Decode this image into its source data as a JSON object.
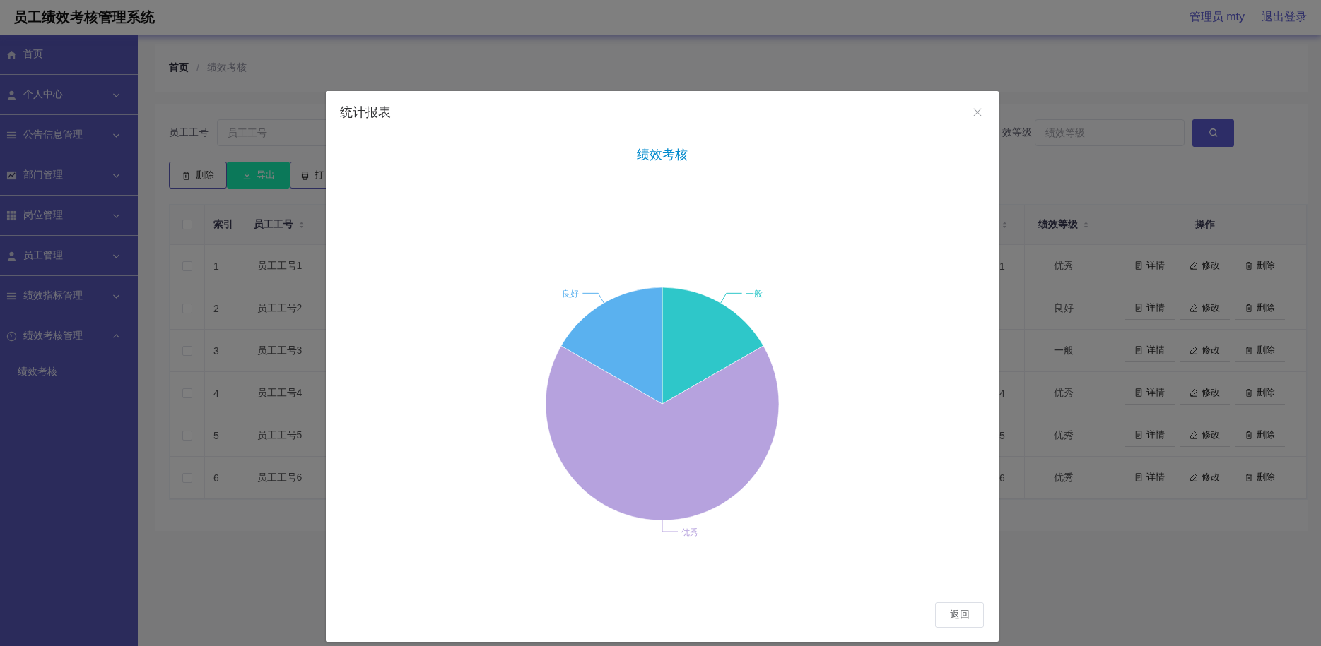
{
  "header": {
    "title": "员工绩效考核管理系统",
    "user": "管理员 mty",
    "logout": "退出登录"
  },
  "sidebar": {
    "items": [
      {
        "label": "首页"
      },
      {
        "label": "个人中心",
        "expanded": false
      },
      {
        "label": "公告信息管理",
        "expanded": false
      },
      {
        "label": "部门管理",
        "expanded": false
      },
      {
        "label": "岗位管理",
        "expanded": false
      },
      {
        "label": "员工管理",
        "expanded": false
      },
      {
        "label": "绩效指标管理",
        "expanded": false
      },
      {
        "label": "绩效考核管理",
        "expanded": true,
        "children": [
          {
            "label": "绩效考核"
          }
        ]
      }
    ]
  },
  "breadcrumb": {
    "items": [
      "首页",
      "绩效考核"
    ],
    "separator": "/"
  },
  "search": {
    "fields": [
      {
        "label": "员工工号",
        "placeholder": "员工工号"
      },
      {
        "label": "效等级",
        "placeholder": "绩效等级"
      }
    ]
  },
  "toolbar": [
    {
      "label": "删除",
      "kind": "outline"
    },
    {
      "label": "导出",
      "kind": "filled"
    },
    {
      "label": "打",
      "kind": "outline"
    }
  ],
  "table": {
    "header": {
      "checked": false,
      "columns": [
        {
          "label": "索引",
          "sortable": false
        },
        {
          "label": "员工工号",
          "sortable": true
        },
        {
          "sortable": true
        },
        {
          "label": "绩效等级",
          "sortable": true
        },
        {
          "label": "操作",
          "sortable": false
        }
      ]
    },
    "rows": [
      {
        "checked": false,
        "index": "1",
        "employee_no": "员工工号1",
        "column_fragment": "1",
        "grade": "优秀",
        "actions": [
          "详情",
          "修改",
          "删除"
        ]
      },
      {
        "checked": false,
        "index": "2",
        "employee_no": "员工工号2",
        "grade": "良好",
        "actions": [
          "详情",
          "修改",
          "删除"
        ]
      },
      {
        "checked": false,
        "index": "3",
        "employee_no": "员工工号3",
        "grade": "一般",
        "actions": [
          "详情",
          "修改",
          "删除"
        ]
      },
      {
        "checked": false,
        "index": "4",
        "employee_no": "员工工号4",
        "column_fragment": "4",
        "grade": "优秀",
        "actions": [
          "详情",
          "修改",
          "删除"
        ]
      },
      {
        "checked": false,
        "index": "5",
        "employee_no": "员工工号5",
        "column_fragment": "5",
        "grade": "优秀",
        "actions": [
          "详情",
          "修改",
          "删除"
        ]
      },
      {
        "checked": false,
        "index": "6",
        "employee_no": "员工工号6",
        "column_fragment": "6",
        "grade": "优秀",
        "actions": [
          "详情",
          "修改",
          "删除"
        ]
      }
    ]
  },
  "dialog": {
    "title": "统计报表",
    "chart_data": {
      "type": "pie",
      "title": "绩效考核",
      "categories": [
        "一般",
        "优秀",
        "良好"
      ],
      "values": [
        16.7,
        66.6,
        16.7
      ],
      "colors": [
        "#2ec7c9",
        "#b6a2de",
        "#5ab1ef"
      ]
    },
    "buttons": [
      "返回"
    ]
  }
}
